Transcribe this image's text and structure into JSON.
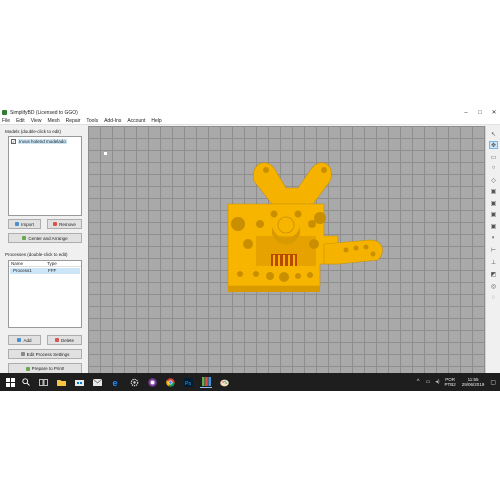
{
  "window": {
    "title": "SimplifyBD (Licensed to GGO)",
    "controls": [
      "–",
      "□",
      "✕"
    ]
  },
  "menu": [
    "File",
    "Edit",
    "View",
    "Mesh",
    "Repair",
    "Tools",
    "Add-Ins",
    "Account",
    "Help"
  ],
  "models": {
    "label": "Models (double-click to edit)",
    "items": [
      {
        "name": "Invus hotend modelado",
        "checked": true
      }
    ],
    "import_label": "Import",
    "remove_label": "Remove",
    "center_label": "Center and Arrange"
  },
  "processes": {
    "label": "Processes (double-click to edit)",
    "columns": [
      "Name",
      "Type"
    ],
    "rows": [
      {
        "name": "Process1",
        "type": "FFF"
      }
    ],
    "add_label": "Add",
    "delete_label": "Delete",
    "edit_label": "Edit Process Settings",
    "prepare_label": "Prepare to Print!"
  },
  "viewport": {
    "model_color": "#f7b500",
    "grid_color": "#a9a9a9"
  },
  "toolbar_icons": [
    "cursor-icon",
    "move-icon",
    "fit-view-icon",
    "rotate-icon",
    "view-top-icon",
    "view-front-icon",
    "view-left-icon",
    "view-right-icon",
    "view-back-icon",
    "view-bottom-icon",
    "axis-icon",
    "cross-section-icon",
    "build-volume-icon",
    "grid-icon",
    "settings-icon"
  ],
  "taskbar": {
    "apps": [
      "windows-start-icon",
      "search-icon",
      "task-view-icon",
      "file-explorer-icon",
      "store-icon",
      "mail-icon",
      "edge-icon",
      "settings-app-icon",
      "obs-icon",
      "chrome-icon",
      "photoshop-icon",
      "simplify3d-icon",
      "paint-icon"
    ],
    "lang_line1": "POR",
    "lang_line2": "PTB2",
    "time": "11:55",
    "date": "29/06/2019"
  }
}
